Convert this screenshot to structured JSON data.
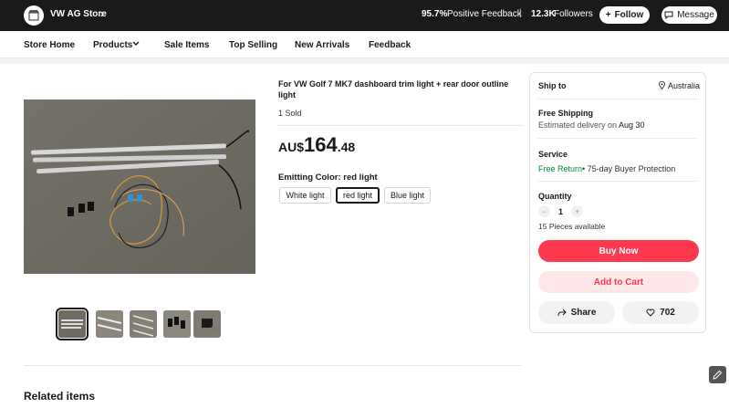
{
  "store": {
    "name": "VW AG Store",
    "feedback_percent": "95.7%",
    "feedback_label": "Positive Feedback",
    "separator": "|",
    "followers_count": "12.3K",
    "followers_label": "Followers",
    "follow_label": "Follow",
    "message_label": "Message"
  },
  "nav": {
    "items": [
      "Store Home",
      "Products",
      "Sale Items",
      "Top Selling",
      "New Arrivals",
      "Feedback"
    ]
  },
  "product": {
    "title": "For VW Golf 7 MK7 dashboard trim light + rear door outline light",
    "sold": "1 Sold",
    "price_currency": "AU$",
    "price_int": "164",
    "price_dec": ".48",
    "color_label": "Emitting Color: red light",
    "options": [
      "White light",
      "red light",
      "Blue light"
    ],
    "selected_option": "red light"
  },
  "panel": {
    "ship_to_label": "Ship to",
    "ship_to_country": "Australia",
    "shipping_title": "Free Shipping",
    "delivery_prefix": "Estimated delivery on",
    "delivery_date": "Aug 30",
    "service_title": "Service",
    "free_return": "Free Return",
    "buyer_protection": "• 75-day Buyer Protection",
    "quantity_title": "Quantity",
    "quantity_value": "1",
    "minus": "−",
    "plus": "+",
    "available": "15 Pieces available",
    "buy_now": "Buy Now",
    "add_to_cart": "Add to Cart",
    "share": "Share",
    "wishlist_count": "702"
  },
  "related_title": "Related items",
  "colors": {
    "accent_red": "#fd384f",
    "free_return_green": "#008a3e",
    "top_bar": "#1a1a1a"
  }
}
